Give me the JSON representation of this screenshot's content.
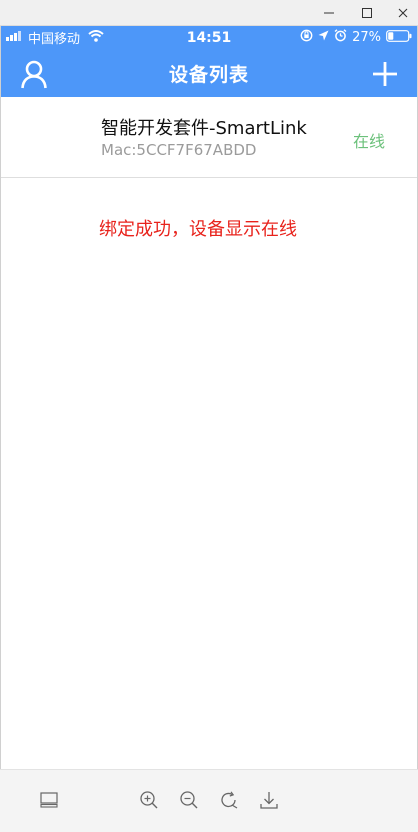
{
  "window": {
    "minimize_icon": "minimize-icon",
    "maximize_icon": "maximize-icon",
    "close_icon": "close-icon"
  },
  "status_bar": {
    "carrier": "中国移动",
    "time": "14:51",
    "battery": "27%",
    "icons": [
      "signal-icon",
      "wifi-icon",
      "orientation-lock-icon",
      "location-icon",
      "alarm-icon",
      "battery-icon"
    ]
  },
  "nav": {
    "title": "设备列表",
    "left_icon": "user-icon",
    "right_icon": "plus-icon"
  },
  "devices": [
    {
      "name": "智能开发套件-SmartLink",
      "mac": "Mac:5CCF7F67ABDD",
      "status": "在线"
    }
  ],
  "note": "绑定成功，设备显示在线",
  "toolbar": {
    "icons": [
      "layout-icon",
      "zoom-in-icon",
      "zoom-out-icon",
      "rotate-icon",
      "download-icon"
    ]
  },
  "colors": {
    "header_blue": "#4d97f9",
    "online_green": "#6cc17b",
    "note_red": "#e8231c"
  }
}
